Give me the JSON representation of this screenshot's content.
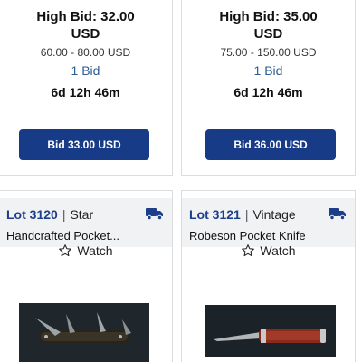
{
  "cards_top": [
    {
      "high_bid_line1": "High Bid: 32.00",
      "high_bid_line2": "USD",
      "estimate": "60.00 - 80.00 USD",
      "bids": "1 Bid",
      "time_left": "6d 12h 46m",
      "bid_button": "Bid 33.00 USD"
    },
    {
      "high_bid_line1": "High Bid: 35.00",
      "high_bid_line2": "USD",
      "estimate": "75.00 - 150.00 USD",
      "bids": "1 Bid",
      "time_left": "6d 12h 46m",
      "bid_button": "Bid 36.00 USD"
    }
  ],
  "cards_bottom": [
    {
      "lot": "Lot 3120",
      "tag": "Star",
      "title": "Handcrafted Pocket...",
      "watch": "Watch",
      "shipping_icon": "truck-icon"
    },
    {
      "lot": "Lot 3121",
      "tag": "Vintage",
      "title": "Robeson Pocket Knife",
      "watch": "Watch",
      "shipping_icon": "truck-icon"
    }
  ],
  "colors": {
    "primary": "#173b86",
    "link": "#2d5c93",
    "header_bg": "#f1f2f4"
  }
}
